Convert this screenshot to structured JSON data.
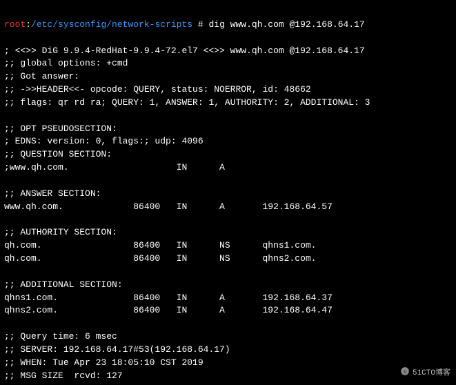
{
  "prompt": {
    "user": "root",
    "sep": ":",
    "path": "/etc/sysconfig/network-scripts",
    "hash": " # ",
    "cmd": "dig www.qh.com @192.168.64.17"
  },
  "lines": {
    "l0": "",
    "l1": "; <<>> DiG 9.9.4-RedHat-9.9.4-72.el7 <<>> www.qh.com @192.168.64.17",
    "l2": ";; global options: +cmd",
    "l3": ";; Got answer:",
    "l4": ";; ->>HEADER<<- opcode: QUERY, status: NOERROR, id: 48662",
    "l5": ";; flags: qr rd ra; QUERY: 1, ANSWER: 1, AUTHORITY: 2, ADDITIONAL: 3",
    "l6": "",
    "l7": ";; OPT PSEUDOSECTION:",
    "l8": "; EDNS: version: 0, flags:; udp: 4096",
    "l9": ";; QUESTION SECTION:",
    "l10": ";www.qh.com.                    IN      A",
    "l11": "",
    "l12": ";; ANSWER SECTION:",
    "l13": "www.qh.com.             86400   IN      A       192.168.64.57",
    "l14": "",
    "l15": ";; AUTHORITY SECTION:",
    "l16": "qh.com.                 86400   IN      NS      qhns1.com.",
    "l17": "qh.com.                 86400   IN      NS      qhns2.com.",
    "l18": "",
    "l19": ";; ADDITIONAL SECTION:",
    "l20": "qhns1.com.              86400   IN      A       192.168.64.37",
    "l21": "qhns2.com.              86400   IN      A       192.168.64.47",
    "l22": "",
    "l23": ";; Query time: 6 msec",
    "l24": ";; SERVER: 192.168.64.17#53(192.168.64.17)",
    "l25": ";; WHEN: Tue Apr 23 18:05:10 CST 2019",
    "l26": ";; MSG SIZE  rcvd: 127"
  },
  "watermark": "51CTO博客",
  "chart_data": {
    "type": "table",
    "title": "dig www.qh.com @192.168.64.17",
    "question": {
      "name": "www.qh.com.",
      "class": "IN",
      "type": "A"
    },
    "answer": [
      {
        "name": "www.qh.com.",
        "ttl": 86400,
        "class": "IN",
        "type": "A",
        "data": "192.168.64.57"
      }
    ],
    "authority": [
      {
        "name": "qh.com.",
        "ttl": 86400,
        "class": "IN",
        "type": "NS",
        "data": "qhns1.com."
      },
      {
        "name": "qh.com.",
        "ttl": 86400,
        "class": "IN",
        "type": "NS",
        "data": "qhns2.com."
      }
    ],
    "additional": [
      {
        "name": "qhns1.com.",
        "ttl": 86400,
        "class": "IN",
        "type": "A",
        "data": "192.168.64.37"
      },
      {
        "name": "qhns2.com.",
        "ttl": 86400,
        "class": "IN",
        "type": "A",
        "data": "192.168.64.47"
      }
    ],
    "meta": {
      "query_time_msec": 6,
      "server": "192.168.64.17#53(192.168.64.17)",
      "when": "Tue Apr 23 18:05:10 CST 2019",
      "msg_size_rcvd": 127,
      "header_id": 48662,
      "status": "NOERROR"
    }
  }
}
